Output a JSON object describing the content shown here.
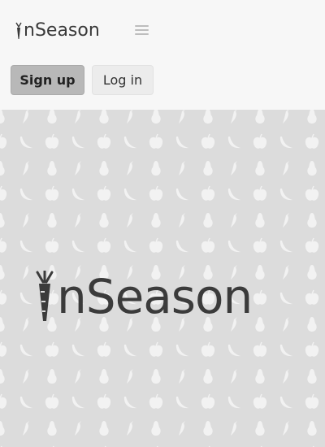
{
  "brand": {
    "name": "inSeason",
    "name_no_i": "nSeason"
  },
  "header": {
    "menu_icon": "hamburger-icon",
    "signup_label": "Sign up",
    "login_label": "Log in"
  },
  "hero": {
    "logo_text": "nSeason",
    "pattern_icons": [
      "pear-icon",
      "pepper-icon",
      "apple-icon",
      "banana-icon"
    ]
  },
  "colors": {
    "header_bg": "#f7f7f7",
    "hero_bg": "#dcdcdc",
    "pattern_fg": "#f2f2f2",
    "signup_bg": "#b8b8b8",
    "login_bg": "#ececec",
    "text": "#3a3a3a"
  }
}
